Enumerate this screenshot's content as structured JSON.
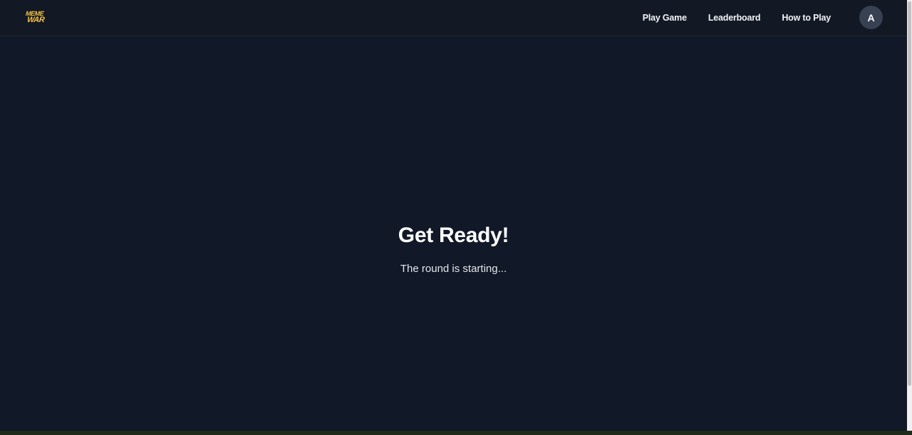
{
  "header": {
    "logo_line1": "MEME",
    "logo_line2": "WAR",
    "logo_color": "#f6c343",
    "nav": [
      {
        "label": "Play Game"
      },
      {
        "label": "Leaderboard"
      },
      {
        "label": "How to Play"
      }
    ],
    "avatar_initial": "A"
  },
  "main": {
    "title": "Get Ready!",
    "subtitle": "The round is starting..."
  },
  "theme": {
    "background": "#111827",
    "navbar_background": "#121824"
  }
}
